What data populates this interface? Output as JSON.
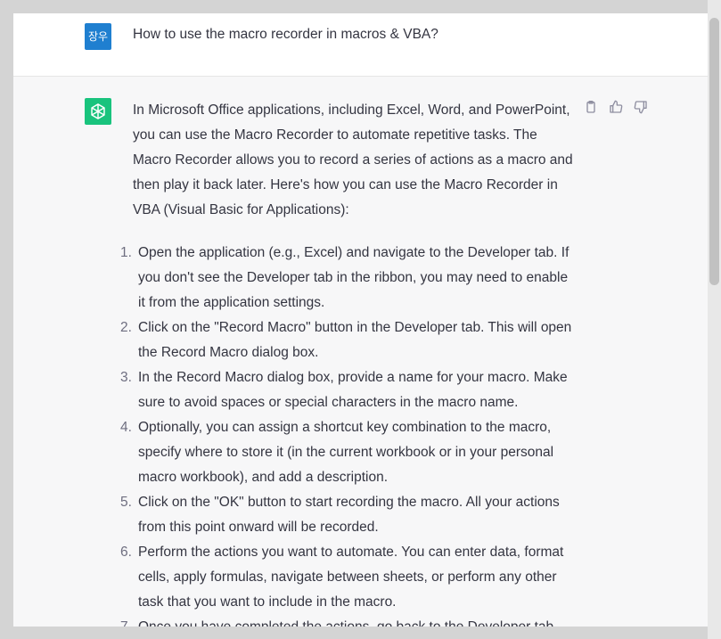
{
  "user": {
    "avatar_text": "장우",
    "message": "How to use the macro recorder in macros & VBA?"
  },
  "assistant": {
    "avatar_icon": "openai-logo-icon",
    "intro": "In Microsoft Office applications, including Excel, Word, and PowerPoint, you can use the Macro Recorder to automate repetitive tasks. The Macro Recorder allows you to record a series of actions as a macro and then play it back later. Here's how you can use the Macro Recorder in VBA (Visual Basic for Applications):",
    "steps": [
      {
        "num": "1.",
        "text": "Open the application (e.g., Excel) and navigate to the Developer tab. If you don't see the Developer tab in the ribbon, you may need to enable it from the application settings."
      },
      {
        "num": "2.",
        "text": "Click on the \"Record Macro\" button in the Developer tab. This will open the Record Macro dialog box."
      },
      {
        "num": "3.",
        "text": "In the Record Macro dialog box, provide a name for your macro. Make sure to avoid spaces or special characters in the macro name."
      },
      {
        "num": "4.",
        "text": "Optionally, you can assign a shortcut key combination to the macro, specify where to store it (in the current workbook or in your personal macro workbook), and add a description."
      },
      {
        "num": "5.",
        "text": "Click on the \"OK\" button to start recording the macro. All your actions from this point onward will be recorded."
      },
      {
        "num": "6.",
        "text": "Perform the actions you want to automate. You can enter data, format cells, apply formulas, navigate between sheets, or perform any other task that you want to include in the macro."
      },
      {
        "num": "7.",
        "text": "Once you have completed the actions, go back to the Developer tab"
      }
    ]
  },
  "actions": {
    "copy_icon": "clipboard-icon",
    "like_icon": "thumbs-up-icon",
    "dislike_icon": "thumbs-down-icon"
  },
  "colors": {
    "user_avatar": "#1f7fd0",
    "gpt_avatar": "#19c37d",
    "text": "#343541"
  }
}
